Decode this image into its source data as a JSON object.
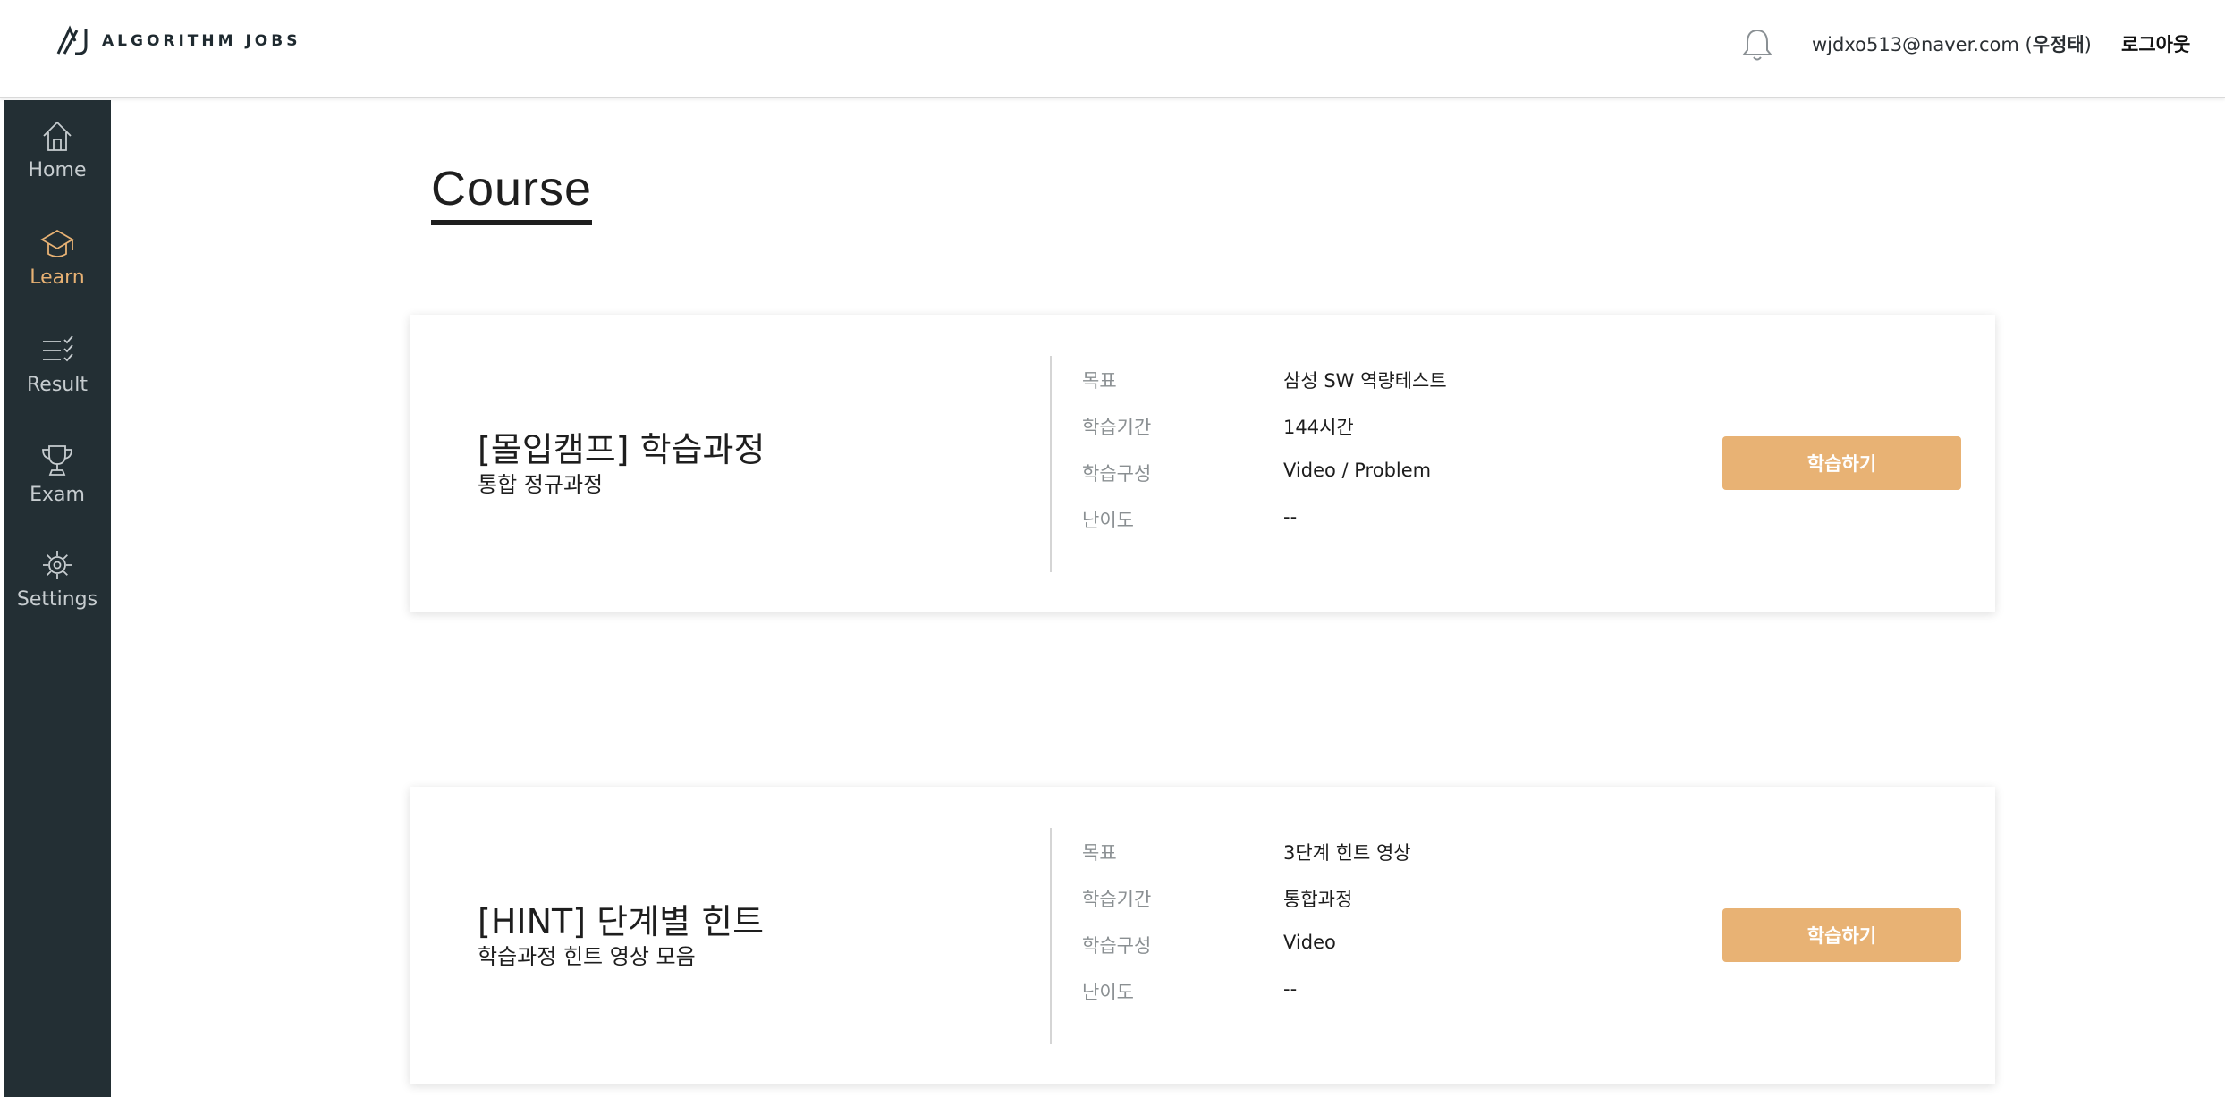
{
  "header": {
    "logo_text": "ALGORITHM JOBS",
    "user_email": "wjdxo513@naver.com",
    "user_name": "우정태",
    "logout_label": "로그아웃"
  },
  "sidebar": {
    "items": [
      {
        "label": "Home",
        "icon": "home-icon",
        "active": false
      },
      {
        "label": "Learn",
        "icon": "graduation-cap-icon",
        "active": true
      },
      {
        "label": "Result",
        "icon": "checklist-icon",
        "active": false
      },
      {
        "label": "Exam",
        "icon": "trophy-icon",
        "active": false
      },
      {
        "label": "Settings",
        "icon": "gear-icon",
        "active": false
      }
    ]
  },
  "main": {
    "page_title": "Course",
    "courses": [
      {
        "title": "[몰입캠프] 학습과정",
        "subtitle": "통합 정규과정",
        "info": [
          {
            "key": "목표",
            "value": "삼성 SW 역량테스트"
          },
          {
            "key": "학습기간",
            "value": "144시간"
          },
          {
            "key": "학습구성",
            "value": "Video / Problem"
          },
          {
            "key": "난이도",
            "value": "--"
          }
        ],
        "button_label": "학습하기"
      },
      {
        "title": "[HINT] 단계별 힌트",
        "subtitle": "학습과정 힌트 영상 모음",
        "info": [
          {
            "key": "목표",
            "value": "3단계 힌트 영상"
          },
          {
            "key": "학습기간",
            "value": "통합과정"
          },
          {
            "key": "학습구성",
            "value": "Video"
          },
          {
            "key": "난이도",
            "value": "--"
          }
        ],
        "button_label": "학습하기"
      }
    ]
  },
  "colors": {
    "sidebar_bg": "#232f34",
    "accent": "#e8b274",
    "sidebar_text": "#c7cdd0"
  }
}
